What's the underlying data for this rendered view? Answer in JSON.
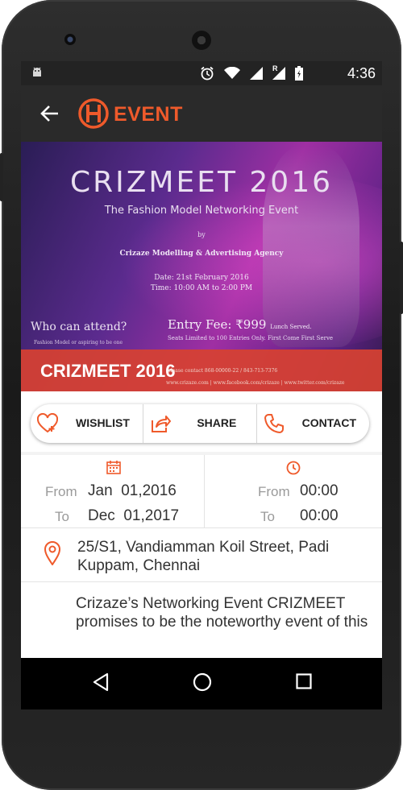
{
  "status_bar": {
    "time": "4:36",
    "icons": [
      "android-icon",
      "alarm-icon",
      "wifi-icon",
      "signal-icon",
      "signal-roaming-icon",
      "battery-icon"
    ],
    "roaming_label": "R"
  },
  "toolbar": {
    "title": "EVENT",
    "logo_letter": "H",
    "accent_color": "#ef5a2b"
  },
  "banner": {
    "poster_title": "CRIZMEET 2016",
    "poster_subtitle": "The Fashion Model Networking Event",
    "by": "by",
    "agency": "Crizaze Modelling & Advertising Agency",
    "date_line": "Date: 21st February 2016",
    "time_line": "Time: 10:00 AM to 2:00 PM",
    "who_can_attend": "Who can attend?",
    "attendee_line": "Fashion Model or aspiring to be one",
    "entry_fee_label": "Entry Fee:",
    "entry_fee_value": "₹999",
    "entry_fee_note": "Lunch Served.",
    "seats_line": "Seats Limited to 100 Entries Only. First Come First Serve",
    "contact_line": "please contact 868-00000-22 / 843-713-7376",
    "social_line": "www.crizaze.com | www.facebook.com/crizaze | www.twitter.com/crizaze",
    "event_title": "CRIZMEET 2016"
  },
  "actions": {
    "wishlist": "WISHLIST",
    "share": "SHARE",
    "contact": "CONTACT"
  },
  "dates": {
    "from_label": "From",
    "to_label": "To",
    "from_date": "Jan  01,2016",
    "to_date": "Dec  01,2017",
    "from_time": "00:00",
    "to_time": "00:00"
  },
  "address": {
    "text": "25/S1, Vandiamman Koil Street, Padi Kuppam, Chennai"
  },
  "description": {
    "text": "Crizaze’s Networking Event CRIZMEET promises to be the noteworthy event of this"
  },
  "colors": {
    "accent": "#ef5a2b",
    "red_band": "#d64132",
    "toolbar_bg": "#2a2a2a",
    "status_bg": "#232323"
  }
}
